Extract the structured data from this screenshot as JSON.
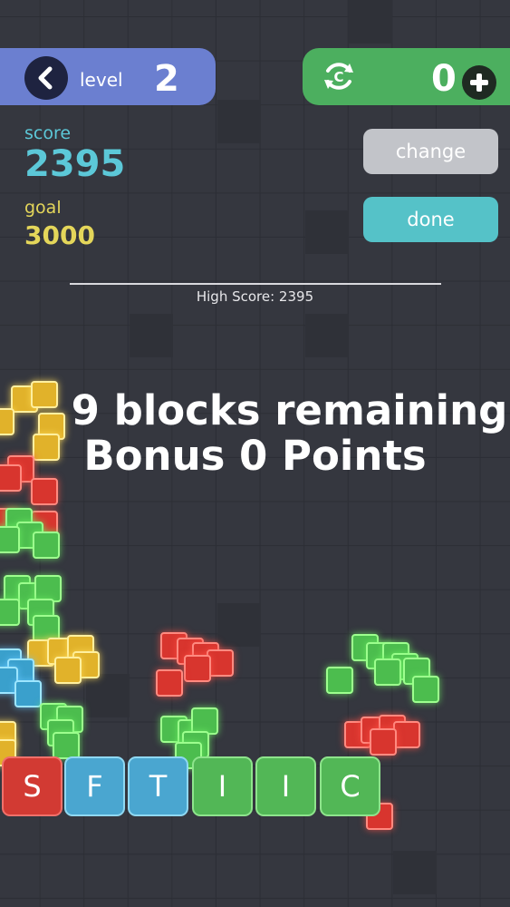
{
  "header": {
    "level_label": "level",
    "level_value": "2",
    "coins_value": "0",
    "back_icon": "chevron-left-icon",
    "refresh_icon": "refresh-coin-icon",
    "add_icon": "plus-icon"
  },
  "stats": {
    "score_label": "score",
    "score_value": "2395",
    "goal_label": "goal",
    "goal_value": "3000"
  },
  "buttons": {
    "change_label": "change",
    "done_label": "done"
  },
  "high_score_text": "High Score: 2395",
  "message": {
    "line1": "9 blocks remaining",
    "line2": "Bonus 0 Points"
  },
  "letter_tiles": [
    {
      "letter": "S",
      "color": "red"
    },
    {
      "letter": "F",
      "color": "blue"
    },
    {
      "letter": "T",
      "color": "blue"
    },
    {
      "letter": "I",
      "color": "green"
    },
    {
      "letter": "I",
      "color": "green"
    },
    {
      "letter": "C",
      "color": "green"
    }
  ],
  "colors": {
    "level_pill": "#6b7fd0",
    "coin_pill": "#4caf5f",
    "score": "#5cc8d8",
    "goal": "#e4d65a",
    "change_button": "#c2c4c9",
    "done_button": "#55c2c8"
  }
}
